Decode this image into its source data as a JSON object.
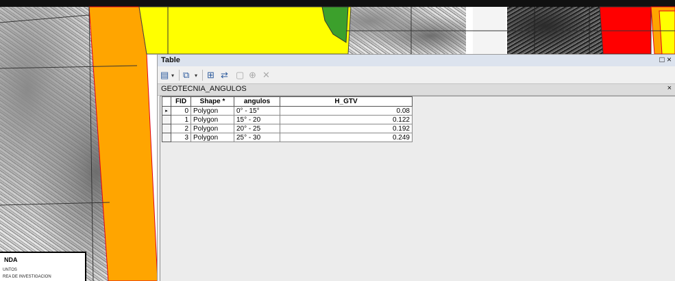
{
  "window": {
    "title": "Table",
    "controls": "□ ×"
  },
  "toolbar": {
    "icons": [
      "table-options-icon",
      "related-tables-icon",
      "select-by-attributes-icon",
      "switch-selection-icon",
      "clear-selection-icon",
      "zoom-to-selected-icon",
      "delete-selected-icon"
    ]
  },
  "layer_tab": {
    "label": "GEOTECNIA_ANGULOS",
    "close": "×"
  },
  "attribute_table": {
    "columns": [
      "FID",
      "Shape *",
      "angulos",
      "H_GTV"
    ],
    "rows": [
      {
        "fid": "0",
        "shape": "Polygon",
        "angulos": "0° - 15°",
        "h_gtv": "0.08"
      },
      {
        "fid": "1",
        "shape": "Polygon",
        "angulos": "15° - 20",
        "h_gtv": "0.122"
      },
      {
        "fid": "2",
        "shape": "Polygon",
        "angulos": "20° - 25",
        "h_gtv": "0.192"
      },
      {
        "fid": "3",
        "shape": "Polygon",
        "angulos": "25° - 30",
        "h_gtv": "0.249"
      }
    ],
    "current_row_marker": "▸"
  },
  "legend": {
    "title": "NDA",
    "items": [
      "UNTOS",
      "REA DE INVESTIGACION"
    ]
  },
  "map_colors": {
    "orange": "#ffa500",
    "yellow": "#ffff00",
    "green": "#3ca02c",
    "red": "#ff0000",
    "outline": "#e0001a"
  }
}
